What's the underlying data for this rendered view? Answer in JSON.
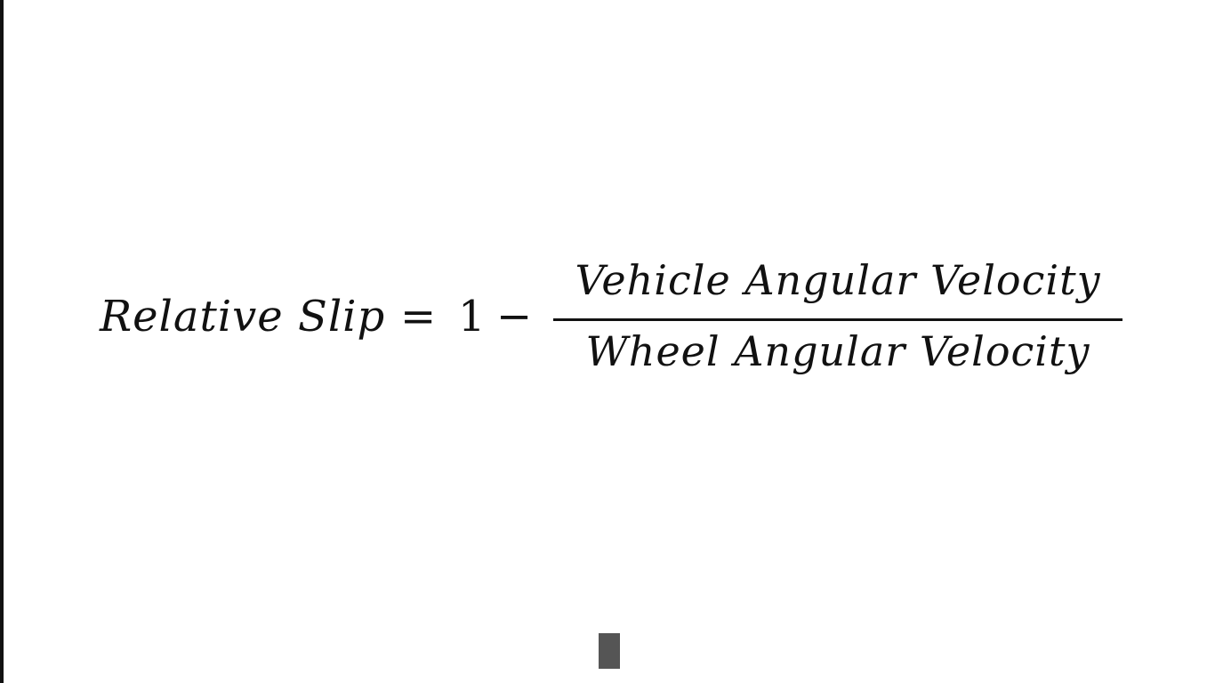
{
  "equation": {
    "lhs": "Relative Slip",
    "equals": "=",
    "one": "1",
    "minus": "−",
    "numerator": "Vehicle Angular Velocity",
    "denominator": "Wheel Angular Velocity"
  },
  "colors": {
    "background": "#ffffff",
    "text": "#111111",
    "left_edge": "#111111",
    "cursor": "#555555"
  }
}
